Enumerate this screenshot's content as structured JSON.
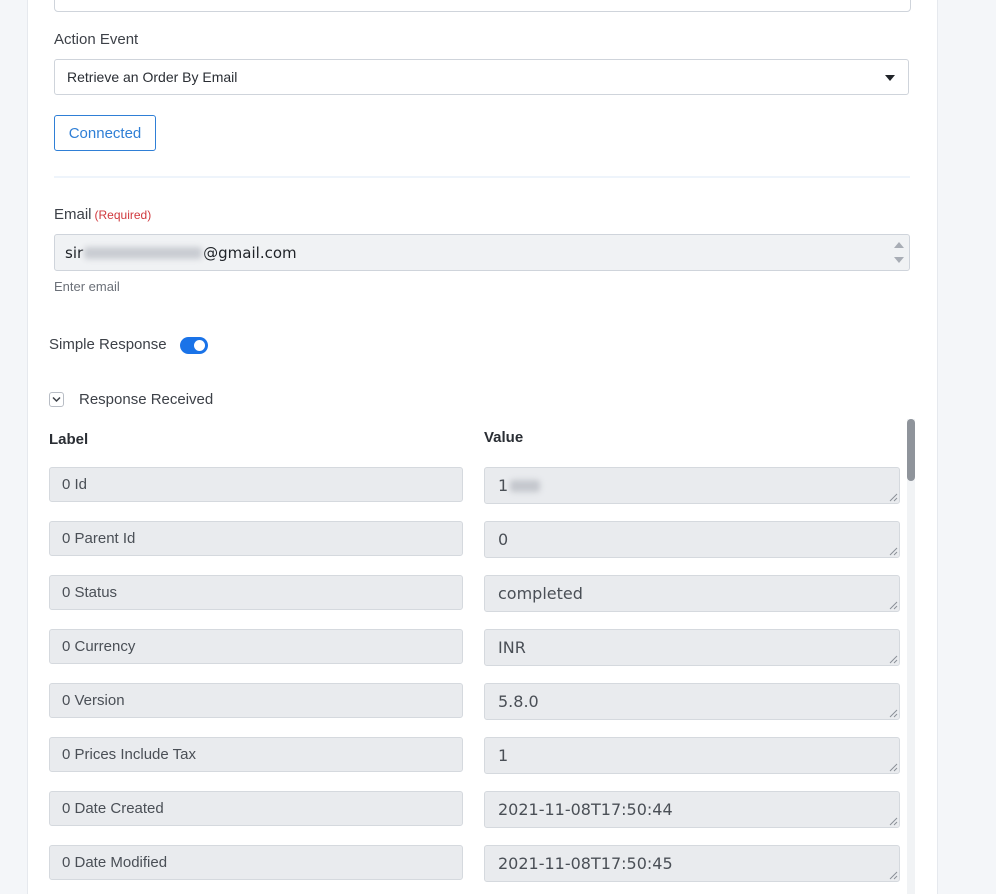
{
  "action_event": {
    "label": "Action Event",
    "selected": "Retrieve an Order By Email"
  },
  "connected_button": "Connected",
  "email": {
    "label": "Email",
    "required": "(Required)",
    "value_prefix": "sir",
    "value_suffix": "@gmail.com",
    "hint": "Enter email"
  },
  "simple_response": {
    "label": "Simple Response",
    "enabled": true
  },
  "response": {
    "title": "Response Received",
    "label_header": "Label",
    "value_header": "Value",
    "rows": [
      {
        "label": "0 Id",
        "value": "1"
      },
      {
        "label": "0 Parent Id",
        "value": "0"
      },
      {
        "label": "0 Status",
        "value": "completed"
      },
      {
        "label": "0 Currency",
        "value": "INR"
      },
      {
        "label": "0 Version",
        "value": "5.8.0"
      },
      {
        "label": "0 Prices Include Tax",
        "value": "1"
      },
      {
        "label": "0 Date Created",
        "value": "2021-11-08T17:50:44"
      },
      {
        "label": "0 Date Modified",
        "value": "2021-11-08T17:50:45"
      }
    ]
  },
  "colors": {
    "accent": "#2f7fd6",
    "toggle_on": "#1a73e8",
    "required": "#d0393e"
  }
}
